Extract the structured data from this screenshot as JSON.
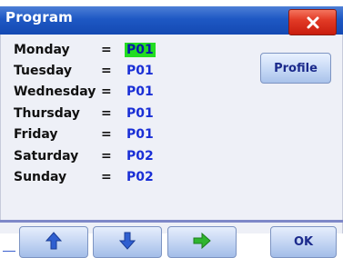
{
  "window": {
    "title": "Program",
    "close_icon": "close-x-icon"
  },
  "schedule": [
    {
      "day": "Monday",
      "program": "P01",
      "selected": true
    },
    {
      "day": "Tuesday",
      "program": "P01",
      "selected": false
    },
    {
      "day": "Wednesday",
      "program": "P01",
      "selected": false
    },
    {
      "day": "Thursday",
      "program": "P01",
      "selected": false
    },
    {
      "day": "Friday",
      "program": "P01",
      "selected": false
    },
    {
      "day": "Saturday",
      "program": "P02",
      "selected": false
    },
    {
      "day": "Sunday",
      "program": "P02",
      "selected": false
    }
  ],
  "equals_sign": "=",
  "buttons": {
    "profile_label": "Profile",
    "ok_label": "OK",
    "up_icon": "arrow-up-icon",
    "down_icon": "arrow-down-icon",
    "right_icon": "arrow-right-icon"
  },
  "colors": {
    "titlebar": "#1e58c4",
    "close_button": "#e23b26",
    "selection": "#22dd22",
    "program_text": "#1a2fd6",
    "arrow_blue": "#2f5fd0",
    "arrow_green": "#2fb52f"
  }
}
